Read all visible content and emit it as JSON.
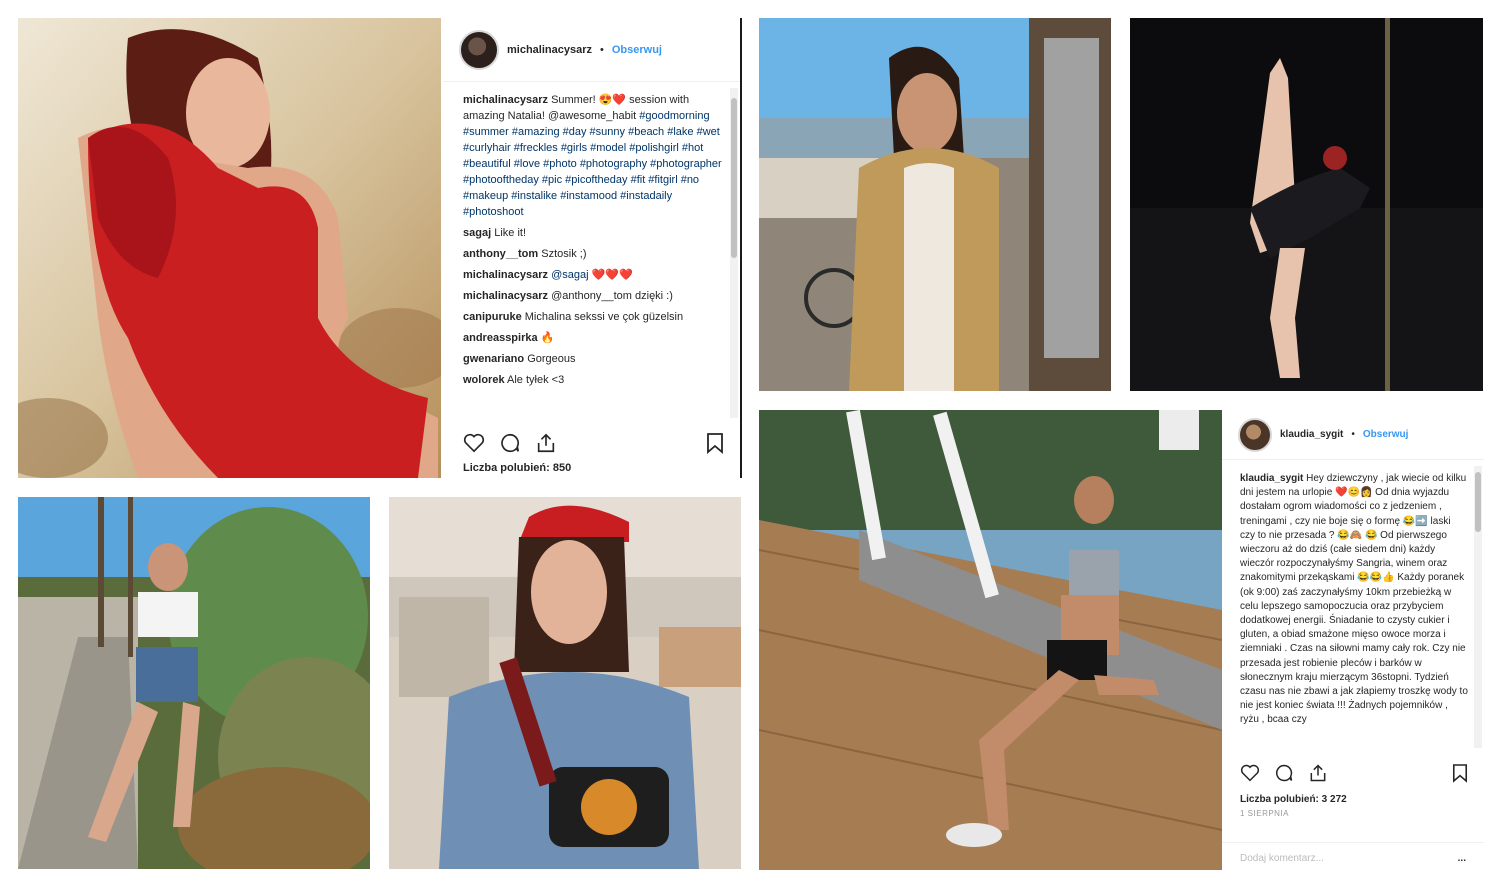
{
  "post1": {
    "username": "michalinacysarz",
    "follow_label": "Obserwuj",
    "caption_user": "michalinacysarz",
    "caption_text": "Summer! 😍❤️ session with amazing Natalia! @awesome_habit",
    "hashtags": "#goodmorning #summer #amazing #day #sunny #beach #lake #wet #curlyhair #freckles #girls #model #polishgirl #hot #beautiful #love #photo #photography #photographer #photooftheday #pic #picoftheday #fit #fitgirl #no #makeup #instalike #instamood #instadaily #photoshoot",
    "comments": [
      {
        "user": "sagaj",
        "text": "Like it!"
      },
      {
        "user": "anthony__tom",
        "text": "Sztosik ;)"
      },
      {
        "user": "michalinacysarz",
        "text": "@sagaj ❤️❤️❤️"
      },
      {
        "user": "michalinacysarz",
        "text": "@anthony__tom dzięki :)"
      },
      {
        "user": "canipuruke",
        "text": "Michalina sekssi ve çok güzelsin"
      },
      {
        "user": "andreasspirka",
        "text": "🔥"
      },
      {
        "user": "gwenariano",
        "text": "Gorgeous"
      },
      {
        "user": "wolorek",
        "text": "Ale tyłek <3"
      }
    ],
    "likes_text": "Liczba polubień: 850"
  },
  "post2": {
    "username": "klaudia_sygit",
    "follow_label": "Obserwuj",
    "caption_user": "klaudia_sygit",
    "caption_text": "Hey dziewczyny , jak wiecie od kilku dni jestem na urlopie ❤️😊👩 Od dnia wyjazdu dostałam ogrom wiadomości co z jedzeniem , treningami , czy nie boje się o formę 😂➡️ laski czy to nie przesada ? 😂🙈 😂 Od pierwszego wieczoru aż do dziś (całe siedem dni) każdy wieczór rozpoczynałyśmy Sangria, winem oraz znakomitymi przekąskami 😂😂👍 Każdy poranek (ok 9:00) zaś zaczynałyśmy 10km przebieżką w celu lepszego samopoczucia oraz przybyciem dodatkowej energii. Śniadanie to czysty cukier i gluten, a obiad smażone mięso owoce morza i ziemniaki . Czas na siłowni mamy cały rok. Czy nie przesada jest robienie pleców i barków w słonecznym kraju mierzącym 36stopni. Tydzień czasu nas nie zbawi a jak złapiemy troszkę wody to nie jest koniec świata !!! Żadnych pojemników , ryżu , bcaa czy",
    "likes_text": "Liczba polubień: 3 272",
    "date_text": "1 SIERPNIA",
    "add_comment_placeholder": "Dodaj komentarz...",
    "more_label": "..."
  },
  "colors": {
    "link": "#003569",
    "follow": "#3897f0",
    "text": "#262626",
    "heart": "#ed4956"
  }
}
